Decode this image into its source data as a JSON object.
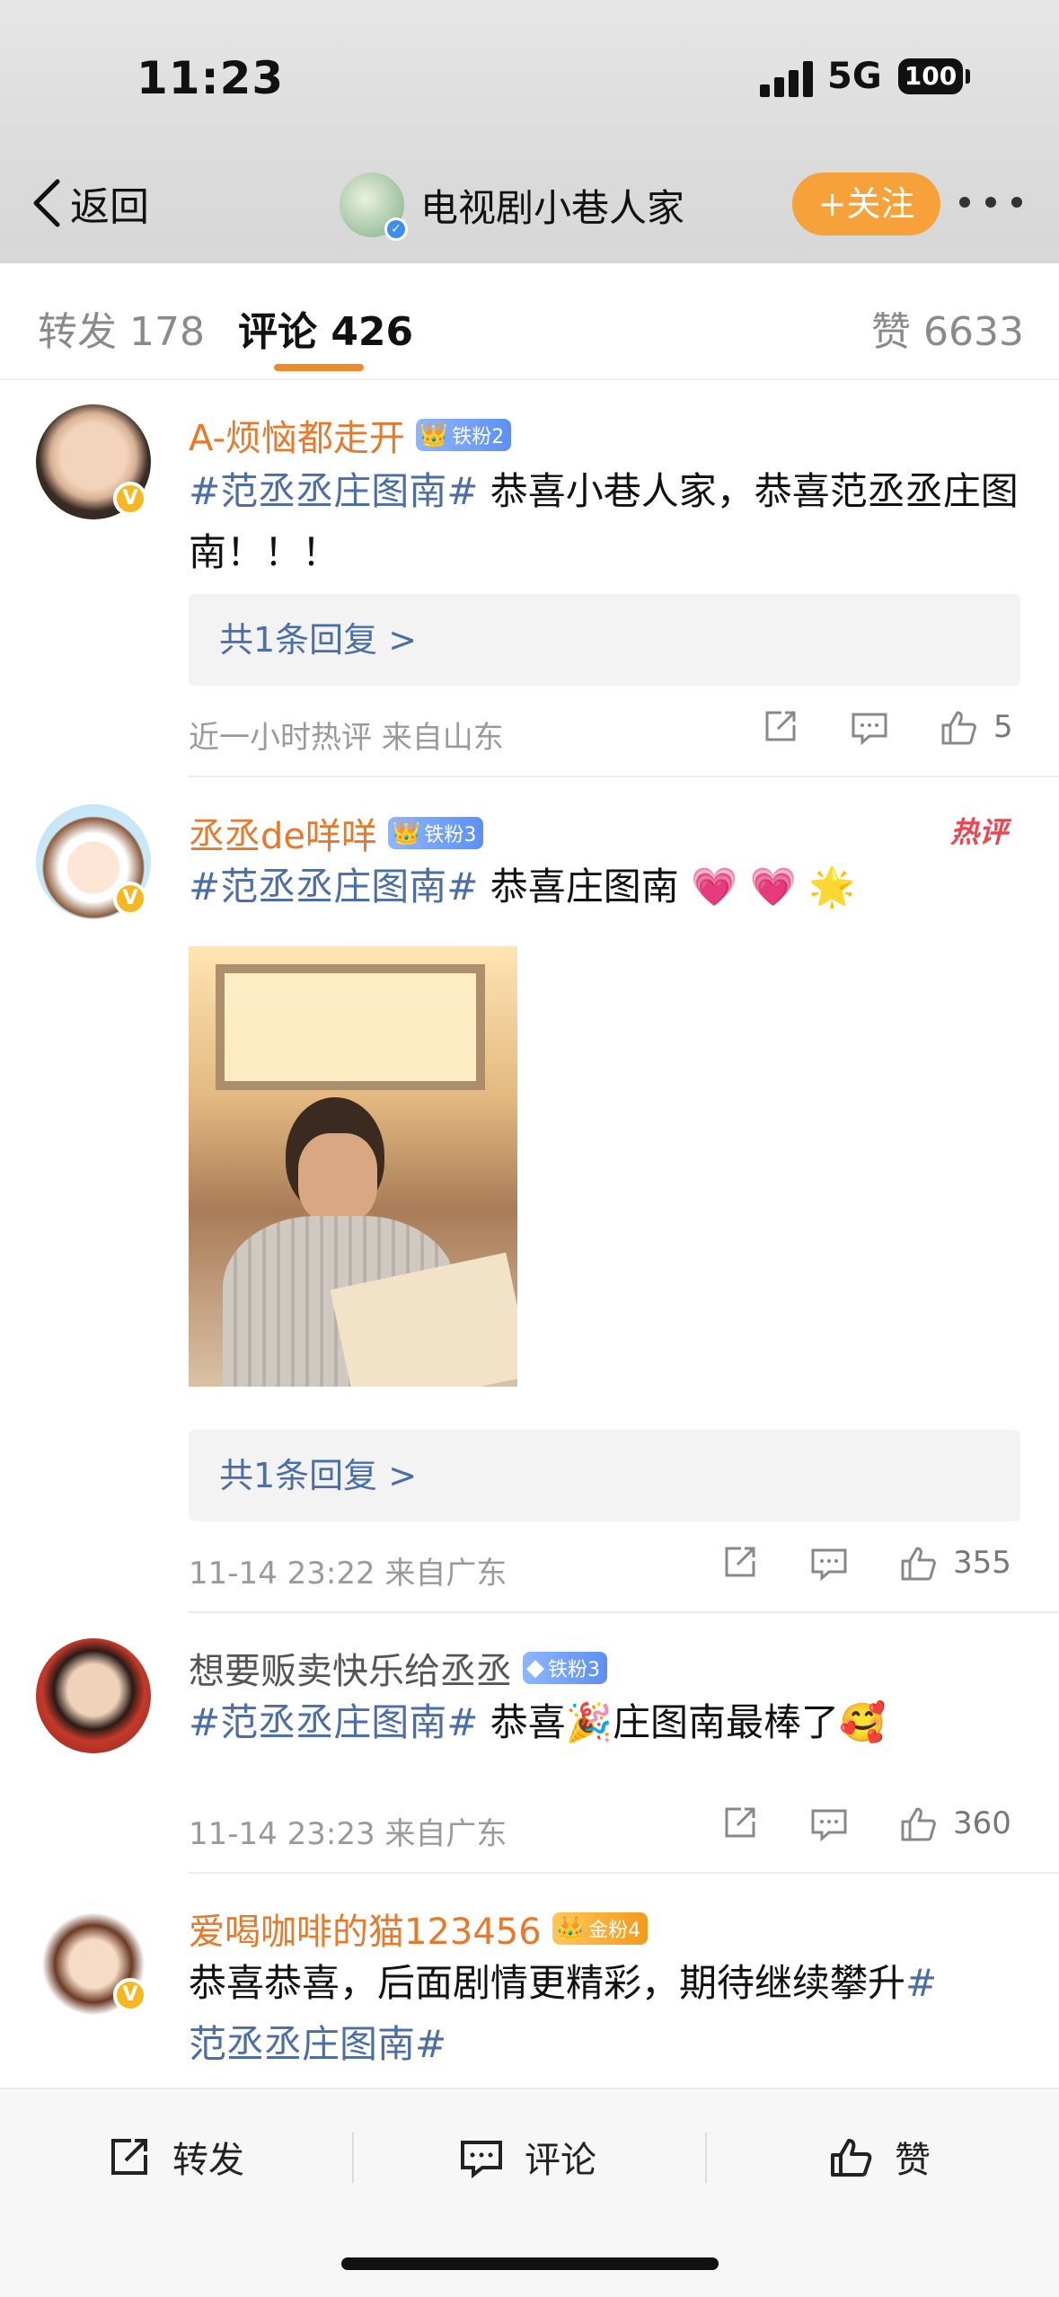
{
  "status_bar": {
    "time": "11:23",
    "network": "5G",
    "battery": "100"
  },
  "header": {
    "back_label": "返回",
    "account_name": "电视剧小巷人家",
    "follow_label": "+关注"
  },
  "tabs": [
    {
      "label": "转发 178"
    },
    {
      "label": "评论 426"
    },
    {
      "label": "赞 6633"
    }
  ],
  "comments": [
    {
      "username": "A-烦恼都走开",
      "badge": "铁粉2",
      "hashtag": "#范丞丞庄图南#",
      "text": " 恭喜小巷人家，恭喜范丞丞庄图南！！！",
      "reply_label": "共1条回复 >",
      "meta": "近一小时热评  来自山东",
      "likes": "5"
    },
    {
      "username": "丞丞de咩咩",
      "badge": "铁粉3",
      "hot_tag": "热评",
      "hashtag": "#范丞丞庄图南#",
      "text": " 恭喜庄图南",
      "emoji": "💗 💗 🌟",
      "reply_label": "共1条回复 >",
      "meta": "11-14 23:22  来自广东",
      "likes": "355"
    },
    {
      "username": "想要贩卖快乐给丞丞",
      "badge": "铁粉3",
      "hashtag": "#范丞丞庄图南#",
      "text_a": " 恭喜",
      "emoji_a": "🎉",
      "text_b": "庄图南最棒了",
      "emoji_b": "🥰",
      "meta": "11-14 23:23  来自广东",
      "likes": "360"
    },
    {
      "username": "爱喝咖啡的猫123456",
      "badge": "金粉4",
      "text": "恭喜恭喜，后面剧情更精彩，期待继续攀升",
      "hashtag_a": "#",
      "hashtag_b": "范丞丞庄图南#"
    }
  ],
  "bottom_bar": {
    "repost": "转发",
    "comment": "评论",
    "like": "赞"
  },
  "colors": {
    "accent": "#f08a2c",
    "hashtag": "#4b6ea8",
    "username": "#e8782a",
    "follow": "#f6a13a"
  }
}
